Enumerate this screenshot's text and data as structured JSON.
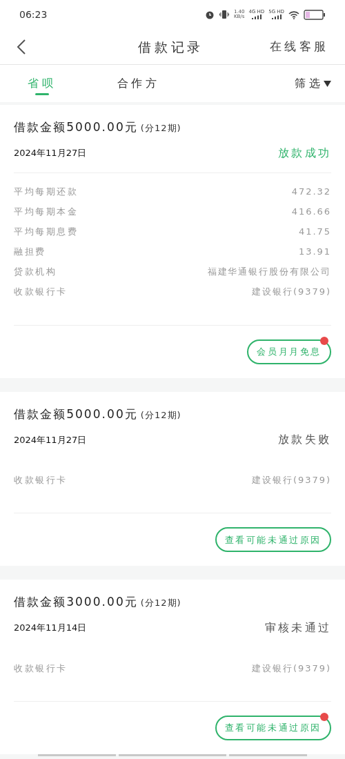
{
  "status_bar": {
    "time": "06:23",
    "speed": "1.40",
    "speed_unit": "KB/s",
    "net_1": "4G HD",
    "net_2": "5G HD"
  },
  "nav": {
    "title": "借款记录",
    "action": "在线客服"
  },
  "tabs": [
    {
      "label": "省呗",
      "selected": true
    },
    {
      "label": "合作方",
      "selected": false
    }
  ],
  "filter": {
    "label": "筛选"
  },
  "loans": [
    {
      "amount": "借款金额5000.00元",
      "term": "(分12期)",
      "date": "2024年11月27日",
      "status": "放款成功",
      "color": "#2fb36b",
      "details": [
        {
          "label": "平均每期还款",
          "value": "472.32"
        },
        {
          "label": "平均每期本金",
          "value": "416.66"
        },
        {
          "label": "平均每期息费",
          "value": "41.75"
        },
        {
          "label": "融担费",
          "value": "13.91"
        },
        {
          "label": "贷款机构",
          "value": "福建华通银行股份有限公司"
        },
        {
          "label": "收款银行卡",
          "value": "建设银行(9379)"
        }
      ],
      "button": "会员月月免息",
      "badge": true
    },
    {
      "amount": "借款金额5000.00元",
      "term": "(分12期)",
      "date": "2024年11月27日",
      "status": "放款失败",
      "color": "#555555",
      "details": [
        {
          "label": "收款银行卡",
          "value": "建设银行(9379)"
        }
      ],
      "button": "查看可能未通过原因",
      "badge": false
    },
    {
      "amount": "借款金额3000.00元",
      "term": "(分12期)",
      "date": "2024年11月14日",
      "status": "审核未通过",
      "color": "#555555",
      "details": [
        {
          "label": "收款银行卡",
          "value": "建设银行(9379)"
        }
      ],
      "button": "查看可能未通过原因",
      "badge": true
    }
  ]
}
